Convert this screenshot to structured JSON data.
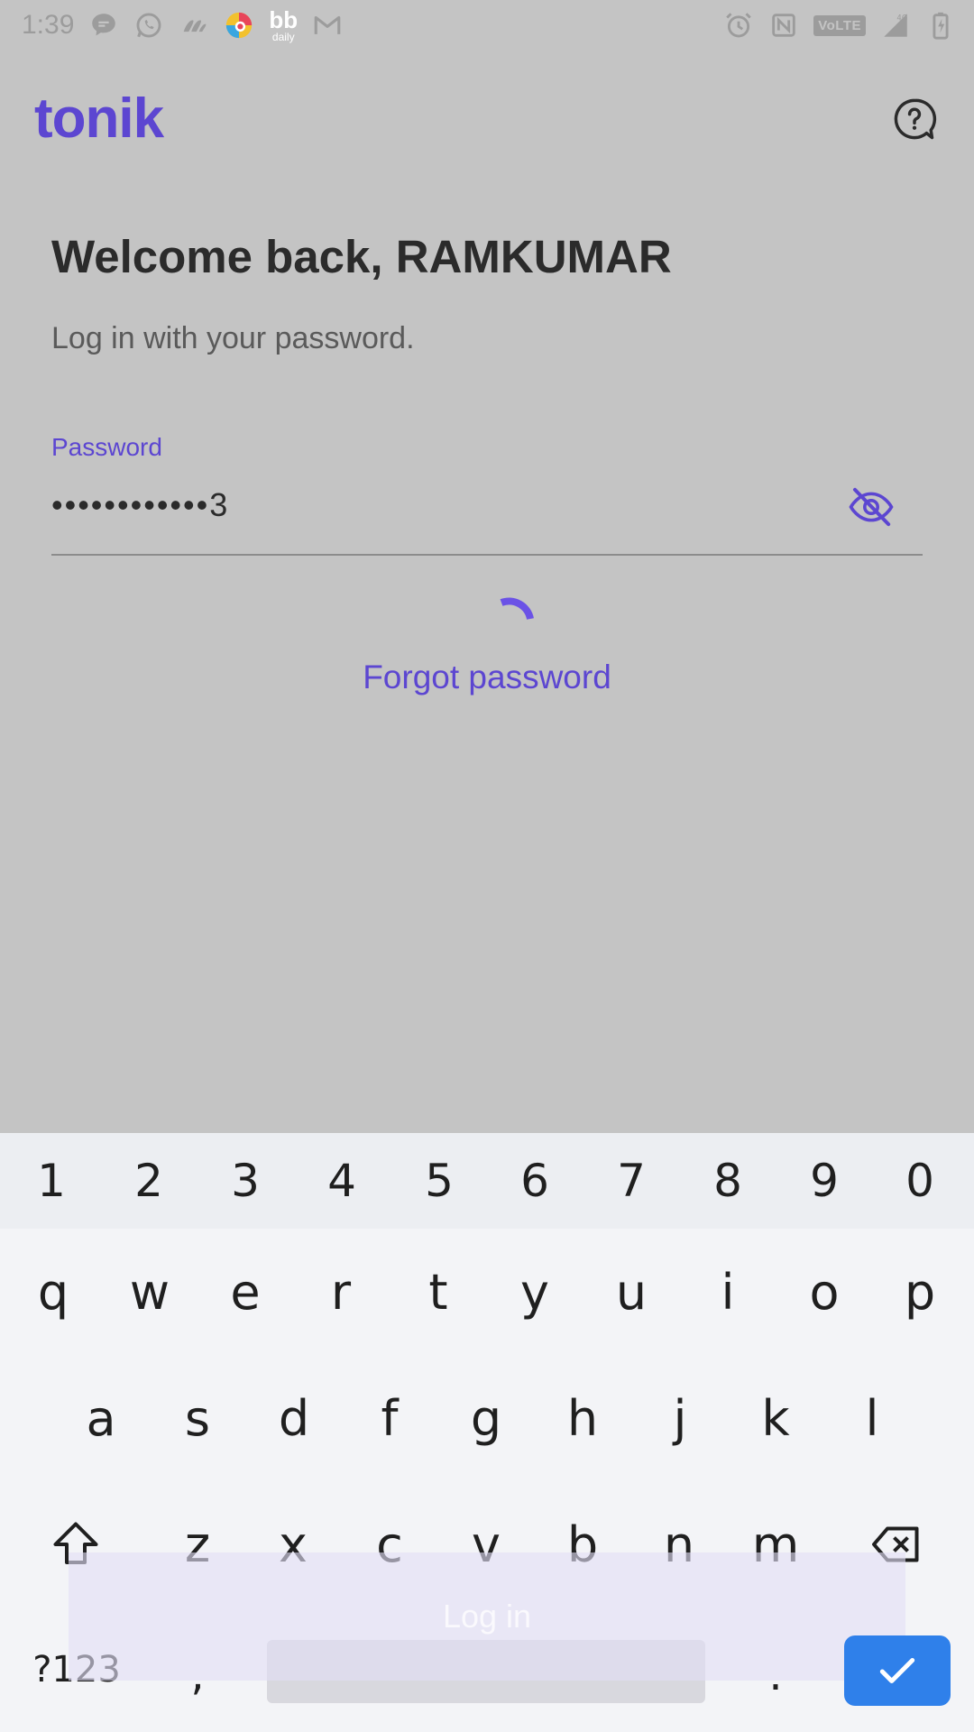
{
  "status_bar": {
    "time": "1:39",
    "bb_label": "bb",
    "bb_sub": "daily",
    "network_badge": "VoLTE",
    "network_type": "4G",
    "icons": [
      "chat-bubble-icon",
      "whatsapp-icon",
      "paw-icon",
      "colorful-app-icon",
      "bb-daily-icon",
      "gmail-icon",
      "alarm-icon",
      "nfc-icon",
      "volte-icon",
      "signal-icon",
      "battery-icon"
    ]
  },
  "header": {
    "logo": "tonik",
    "help_icon": "help-chat-icon"
  },
  "login": {
    "title": "Welcome back, RAMKUMAR",
    "subtitle": "Log in with your password.",
    "password_label": "Password",
    "password_value": "••••••••••••3",
    "visibility_icon": "eye-off-icon",
    "forgot_link": "Forgot password",
    "login_button": "Log in"
  },
  "keyboard": {
    "number_row": [
      "1",
      "2",
      "3",
      "4",
      "5",
      "6",
      "7",
      "8",
      "9",
      "0"
    ],
    "row1": [
      "q",
      "w",
      "e",
      "r",
      "t",
      "y",
      "u",
      "i",
      "o",
      "p"
    ],
    "row2": [
      "a",
      "s",
      "d",
      "f",
      "g",
      "h",
      "j",
      "k",
      "l"
    ],
    "row3": [
      "z",
      "x",
      "c",
      "v",
      "b",
      "n",
      "m"
    ],
    "symbols_key": "?123",
    "comma_key": ",",
    "period_key": ".",
    "enter_icon": "checkmark-icon"
  },
  "colors": {
    "brand": "#5c46d1",
    "background_dim": "#c4c4c4",
    "keyboard_bg": "#f3f4f7",
    "enter_key": "#2f80ea"
  }
}
